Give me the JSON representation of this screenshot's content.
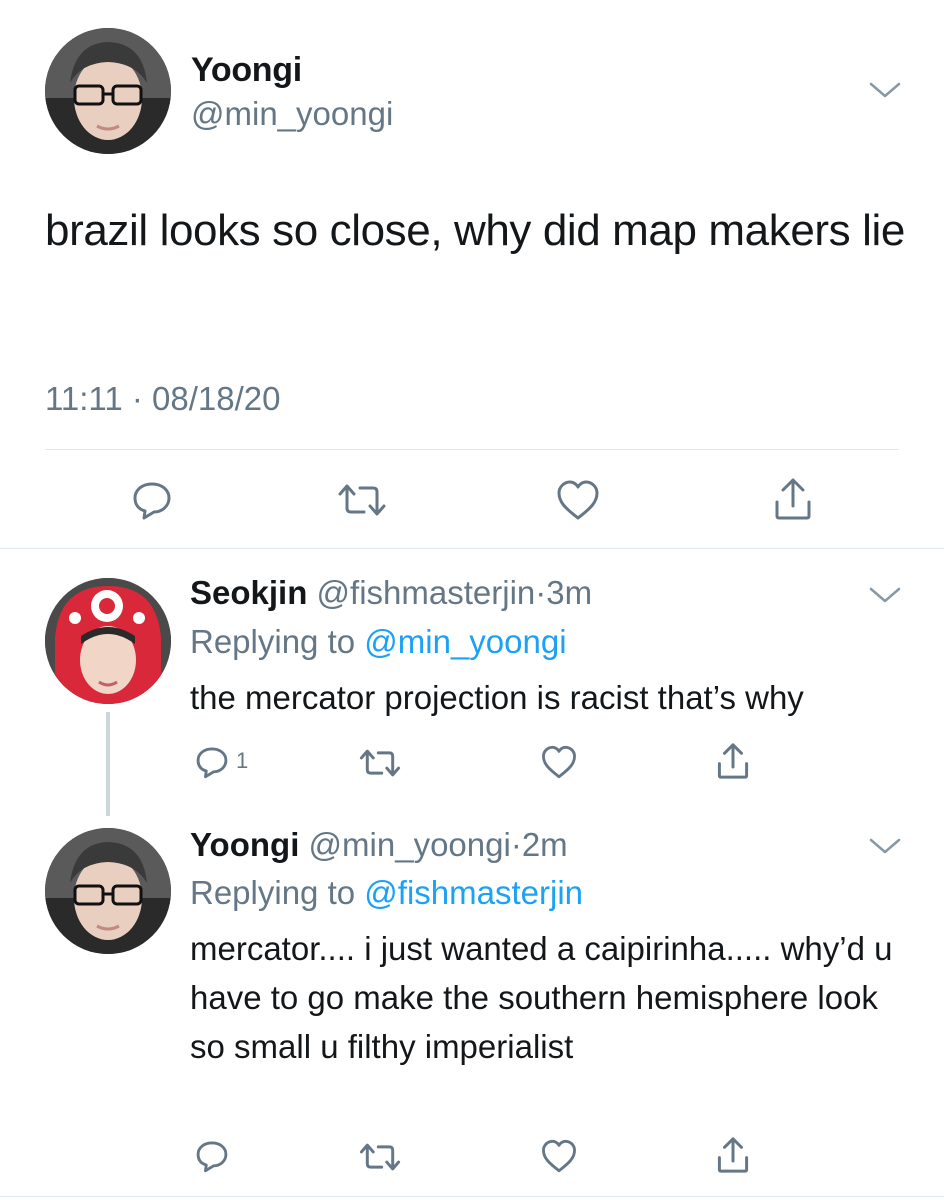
{
  "main_tweet": {
    "display_name": "Yoongi",
    "handle": "@min_yoongi",
    "text": "brazil looks so close, why did map makers lie",
    "timestamp": "11:11 · 08/18/20",
    "avatar_icon": "avatar-yoongi",
    "menu_icon": "chevron-down-icon"
  },
  "replies": [
    {
      "display_name": "Seokjin",
      "handle": "@fishmasterjin",
      "separator": "·",
      "time": "3m",
      "replying_prefix": "Replying to",
      "replying_to": "@min_yoongi",
      "text": "the mercator projection is racist that’s why",
      "reply_count": "1",
      "avatar_icon": "avatar-seokjin"
    },
    {
      "display_name": "Yoongi",
      "handle": "@min_yoongi",
      "separator": "·",
      "time": "2m",
      "replying_prefix": "Replying to",
      "replying_to": "@fishmasterjin",
      "text": "mercator.... i just wanted a caipirinha..... why’d u have to go make the southern hemisphere look so small u filthy imperialist",
      "reply_count": "",
      "avatar_icon": "avatar-yoongi"
    }
  ],
  "colors": {
    "text": "#14171a",
    "secondary": "#657786",
    "link": "#1da1f2",
    "divider": "#e1e8ed"
  }
}
